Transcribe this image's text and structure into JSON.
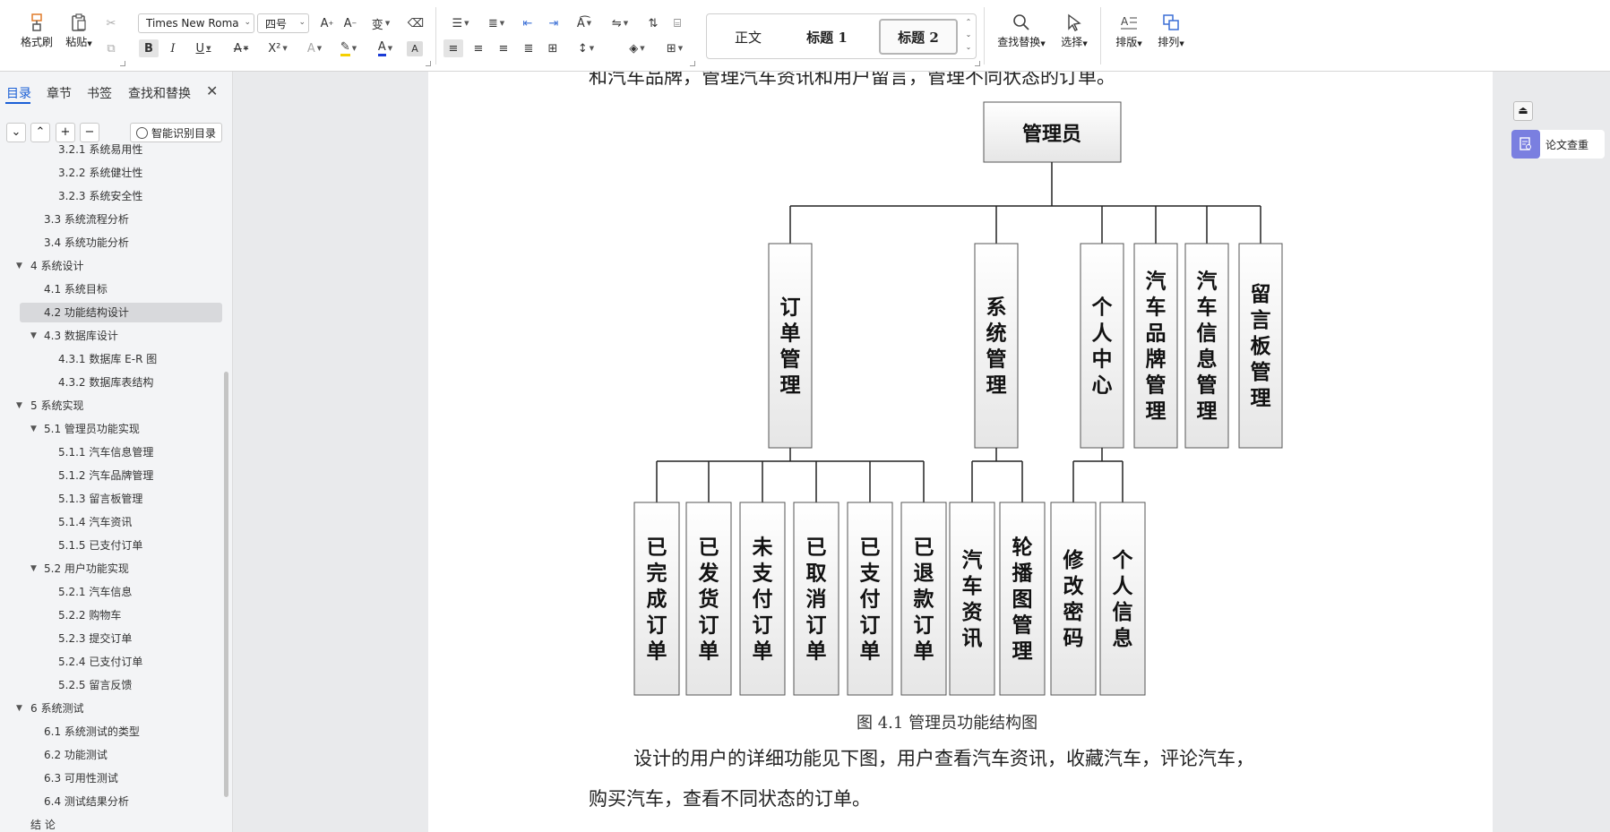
{
  "ribbon": {
    "clipboard": {
      "format_painter": "格式刷",
      "paste": "粘贴"
    },
    "font": {
      "name": "Times New Roma",
      "size": "四号"
    },
    "styles": {
      "normal": "正文",
      "heading1": "标题 1",
      "heading2": "标题 2"
    },
    "find": {
      "find_replace": "查找替换",
      "select": "选择"
    },
    "layout": {
      "typeset": "排版",
      "arrange": "排列"
    }
  },
  "nav": {
    "tabs": [
      "目录",
      "章节",
      "书签",
      "查找和替换"
    ],
    "smart_button": "智能识别目录",
    "items": [
      {
        "label": "3.2.1 系统易用性",
        "level": 3
      },
      {
        "label": "3.2.2 系统健壮性",
        "level": 3
      },
      {
        "label": "3.2.3 系统安全性",
        "level": 3
      },
      {
        "label": "3.3  系统流程分析",
        "level": 2
      },
      {
        "label": "3.4 系统功能分析",
        "level": 2
      },
      {
        "label": "4  系统设计",
        "level": 1,
        "expand": true
      },
      {
        "label": "4.1 系统目标",
        "level": 2
      },
      {
        "label": "4.2 功能结构设计",
        "level": 2,
        "selected": true
      },
      {
        "label": "4.3 数据库设计",
        "level": 2,
        "expand": true
      },
      {
        "label": "4.3.1 数据库 E-R 图",
        "level": 3
      },
      {
        "label": "4.3.2  数据库表结构",
        "level": 3
      },
      {
        "label": "5  系统实现",
        "level": 1,
        "expand": true
      },
      {
        "label": "5.1  管理员功能实现",
        "level": 2,
        "expand": true
      },
      {
        "label": "5.1.1  汽车信息管理",
        "level": 3
      },
      {
        "label": "5.1.2  汽车品牌管理",
        "level": 3
      },
      {
        "label": "5.1.3  留言板管理",
        "level": 3
      },
      {
        "label": "5.1.4  汽车资讯",
        "level": 3
      },
      {
        "label": "5.1.5  已支付订单",
        "level": 3
      },
      {
        "label": "5.2  用户功能实现",
        "level": 2,
        "expand": true
      },
      {
        "label": "5.2.1  汽车信息",
        "level": 3
      },
      {
        "label": "5.2.2  购物车",
        "level": 3
      },
      {
        "label": "5.2.3  提交订单",
        "level": 3
      },
      {
        "label": "5.2.4  已支付订单",
        "level": 3
      },
      {
        "label": "5.2.5  留言反馈",
        "level": 3
      },
      {
        "label": "6 系统测试",
        "level": 1,
        "expand": true
      },
      {
        "label": "6.1  系统测试的类型",
        "level": 2
      },
      {
        "label": "6.2  功能测试",
        "level": 2
      },
      {
        "label": "6.3  可用性测试",
        "level": 2
      },
      {
        "label": "6.4  测试结果分析",
        "level": 2
      },
      {
        "label": "结  论",
        "level": 1
      }
    ]
  },
  "document": {
    "top_line": "和汽车品牌，管理汽车资讯和用户留言，管理不同状态的订单。",
    "diagram": {
      "root": "管理员",
      "level1": [
        "订单管理",
        "系统管理",
        "个人中心",
        "汽车品牌管理",
        "汽车信息管理",
        "留言板管理"
      ],
      "level2": [
        "已完成订单",
        "已发货订单",
        "未支付订单",
        "已取消订单",
        "已支付订单",
        "已退款订单",
        "汽车资讯",
        "轮播图管理",
        "修改密码",
        "个人信息"
      ]
    },
    "caption": "图 4.1  管理员功能结构图",
    "para_line1": "设计的用户的详细功能见下图，用户查看汽车资讯，收藏汽车，评论汽车，",
    "para_line2": "购买汽车，查看不同状态的订单。"
  },
  "right_pane": {
    "plagiarism_check": "论文查重"
  }
}
